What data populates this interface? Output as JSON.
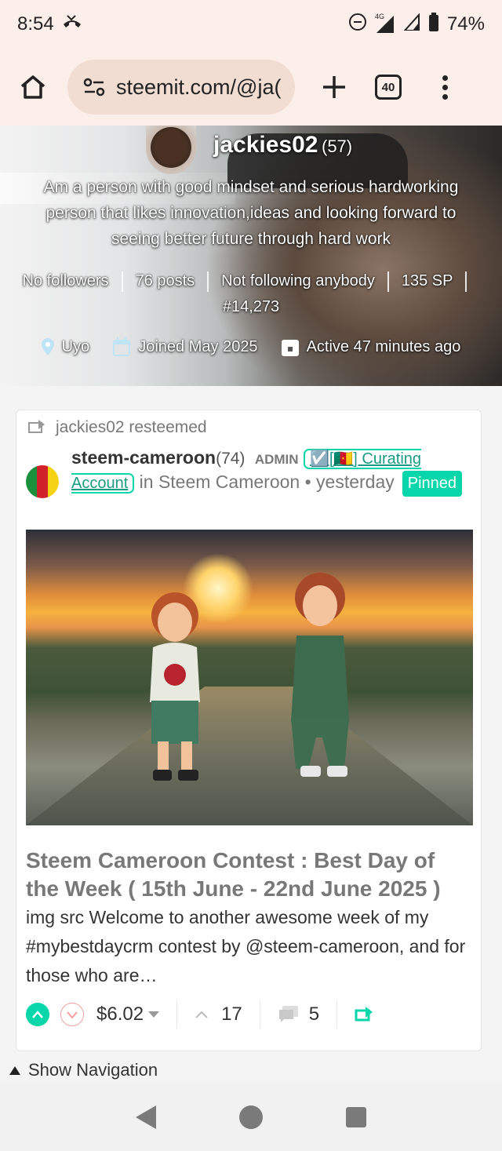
{
  "status_bar": {
    "time": "8:54",
    "network": "4G",
    "battery": "74%"
  },
  "browser": {
    "url": "steemit.com/@ja(",
    "tab_count": "40"
  },
  "profile": {
    "username": "jackies02",
    "reputation": "(57)",
    "about": "Am a person with good mindset and serious hardworking person that likes innovation,ideas and looking forward to seeing better future through hard work",
    "followers": "No followers",
    "posts": "76 posts",
    "following": "Not following anybody",
    "sp": "135 SP",
    "rank": "#14,273",
    "location": "Uyo",
    "joined": "Joined May 2025",
    "active": "Active 47 minutes ago"
  },
  "post": {
    "resteem_label": "jackies02 resteemed",
    "author": "steem-cameroon",
    "author_rep": "(74)",
    "admin_label": "ADMIN",
    "role_badge": "☑️[🇨🇲] Curating Account",
    "community": "in Steem Cameroon",
    "time": "yesterday",
    "pinned_label": "Pinned",
    "title": "Steem Cameroon Contest : Best Day of the Week ( 15th June - 22nd June 2025 )",
    "summary": "img src Welcome to another awesome week of my #mybestdaycrm contest by @steem-cameroon, and for those who are…",
    "payout": "$6.02",
    "votes": "17",
    "comments": "5"
  },
  "footer": {
    "show_navigation": "Show Navigation"
  },
  "colors": {
    "accent": "#06d6a9",
    "header_bg": "#fcefea"
  }
}
